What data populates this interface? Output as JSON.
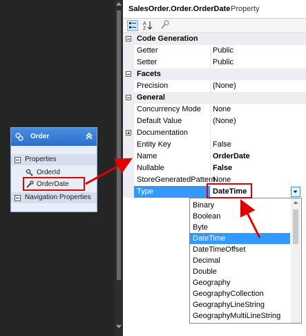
{
  "designer": {
    "entity": {
      "name": "Order",
      "sections": [
        {
          "label": "Properties",
          "items": [
            "OrderId",
            "OrderDate"
          ]
        },
        {
          "label": "Navigation Properties",
          "items": []
        }
      ]
    }
  },
  "properties_window": {
    "object_name": "SalesOrder.Order.OrderDate",
    "object_kind": "Property",
    "toolbar_icons": [
      "categorized-icon",
      "alphabetical-icon",
      "property-pages-icon"
    ],
    "categories": [
      {
        "name": "Code Generation",
        "rows": [
          {
            "name": "Getter",
            "value": "Public"
          },
          {
            "name": "Setter",
            "value": "Public"
          }
        ]
      },
      {
        "name": "Facets",
        "rows": [
          {
            "name": "Precision",
            "value": "(None)"
          }
        ]
      },
      {
        "name": "General",
        "rows": [
          {
            "name": "Concurrency Mode",
            "value": "None"
          },
          {
            "name": "Default Value",
            "value": "(None)"
          },
          {
            "name": "Documentation",
            "value": ""
          },
          {
            "name": "Entity Key",
            "value": "False"
          },
          {
            "name": "Name",
            "value": "OrderDate"
          },
          {
            "name": "Nullable",
            "value": "False"
          },
          {
            "name": "StoreGeneratedPattern",
            "value": "None"
          },
          {
            "name": "Type",
            "value": "DateTime"
          }
        ]
      }
    ],
    "type_dropdown": {
      "selected": "DateTime",
      "options": [
        "Binary",
        "Boolean",
        "Byte",
        "DateTime",
        "DateTimeOffset",
        "Decimal",
        "Double",
        "Geography",
        "GeographyCollection",
        "GeographyLineString",
        "GeographyMultiLineString"
      ]
    }
  },
  "colors": {
    "annotation": "#e00000",
    "selection": "#3399ff",
    "entity_header": "#2a6fcc",
    "designer_background": "#252526"
  }
}
